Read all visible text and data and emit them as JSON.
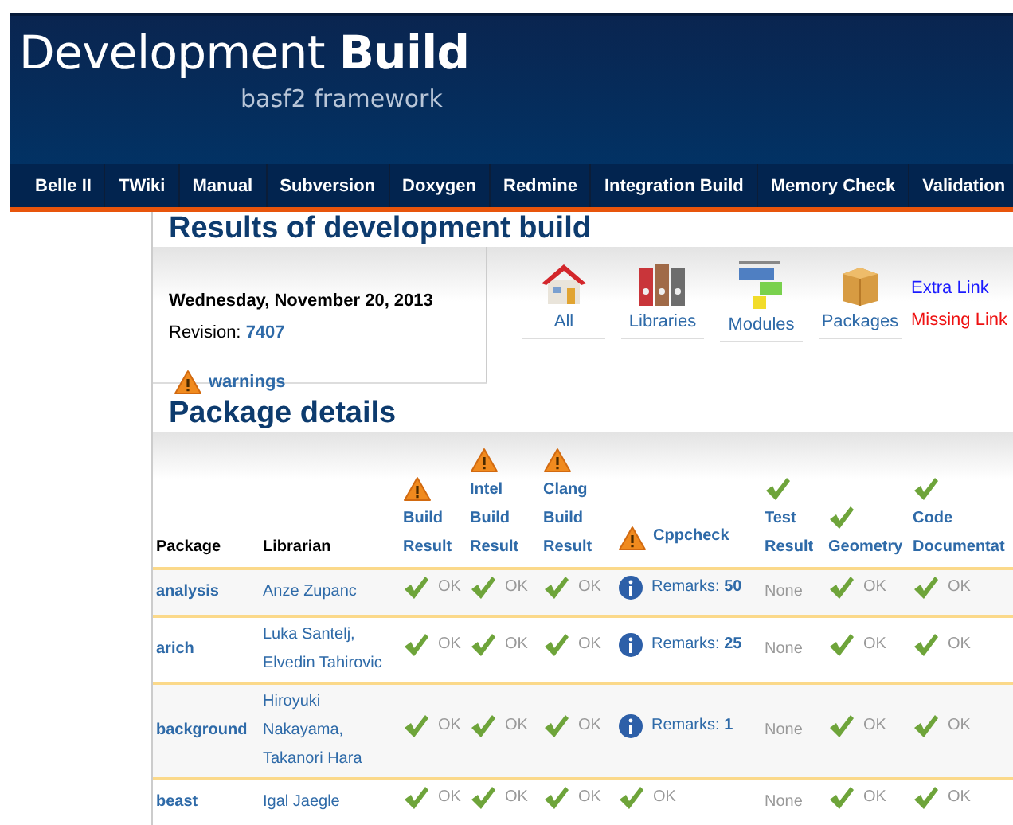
{
  "header": {
    "title": "Development **Build**",
    "subtitle": "basf2 framework"
  },
  "nav": [
    {
      "label": "Belle II"
    },
    {
      "label": "TWiki"
    },
    {
      "label": "Manual"
    },
    {
      "label": "Subversion"
    },
    {
      "label": "Doxygen"
    },
    {
      "label": "Redmine"
    },
    {
      "label": "Integration Build"
    },
    {
      "label": "Memory Check"
    },
    {
      "label": "Validation"
    }
  ],
  "page_title": "Results of development build",
  "summary": {
    "date": "Wednesday, November 20, 2013",
    "revision_label": "Revision:",
    "revision": "7407",
    "warnings": "warnings",
    "views": [
      {
        "kind": "house",
        "label": "All"
      },
      {
        "kind": "binders",
        "label": "Libraries"
      },
      {
        "kind": "blocks",
        "label": "Modules"
      },
      {
        "kind": "box",
        "label": "Packages"
      }
    ],
    "links": [
      {
        "kind": "extra",
        "label": "Extra Link"
      },
      {
        "kind": "missing",
        "label": "Missing Link"
      }
    ]
  },
  "details_title": "Package details",
  "table": {
    "columns": [
      {
        "kind": "plain",
        "label": "Package"
      },
      {
        "kind": "plain",
        "label": "Librarian"
      },
      {
        "kind": "warning",
        "label": "Build Result"
      },
      {
        "kind": "warning",
        "label": "Intel Build Result"
      },
      {
        "kind": "warning",
        "label": "Clang Build Result"
      },
      {
        "kind": "warning",
        "label": "Cppcheck"
      },
      {
        "kind": "ok",
        "label": "Test Result"
      },
      {
        "kind": "ok",
        "label": "Geometry"
      },
      {
        "kind": "ok",
        "label": "Code Documentat"
      }
    ],
    "rows": [
      {
        "cells": [
          {
            "kind": "package",
            "text": "analysis"
          },
          {
            "kind": "librarian",
            "text": "Anze Zupanc"
          },
          {
            "kind": "ok",
            "text": "OK"
          },
          {
            "kind": "ok",
            "text": "OK"
          },
          {
            "kind": "ok",
            "text": "OK"
          },
          {
            "kind": "remarks",
            "text": "Remarks: **50**"
          },
          {
            "kind": "none",
            "text": "None"
          },
          {
            "kind": "ok",
            "text": "OK"
          },
          {
            "kind": "ok",
            "text": "OK"
          }
        ]
      },
      {
        "cells": [
          {
            "kind": "package",
            "text": "arich"
          },
          {
            "kind": "librarian",
            "text": "Luka Santelj, Elvedin Tahirovic"
          },
          {
            "kind": "ok",
            "text": "OK"
          },
          {
            "kind": "ok",
            "text": "OK"
          },
          {
            "kind": "ok",
            "text": "OK"
          },
          {
            "kind": "remarks",
            "text": "Remarks: **25**"
          },
          {
            "kind": "none",
            "text": "None"
          },
          {
            "kind": "ok",
            "text": "OK"
          },
          {
            "kind": "ok",
            "text": "OK"
          }
        ]
      },
      {
        "cells": [
          {
            "kind": "package",
            "text": "background"
          },
          {
            "kind": "librarian",
            "text": "Hiroyuki Nakayama, Takanori Hara"
          },
          {
            "kind": "ok",
            "text": "OK"
          },
          {
            "kind": "ok",
            "text": "OK"
          },
          {
            "kind": "ok",
            "text": "OK"
          },
          {
            "kind": "remarks",
            "text": "Remarks: **1**"
          },
          {
            "kind": "none",
            "text": "None"
          },
          {
            "kind": "ok",
            "text": "OK"
          },
          {
            "kind": "ok",
            "text": "OK"
          }
        ]
      },
      {
        "cells": [
          {
            "kind": "package",
            "text": "beast"
          },
          {
            "kind": "librarian",
            "text": "Igal Jaegle"
          },
          {
            "kind": "ok",
            "text": "OK"
          },
          {
            "kind": "ok",
            "text": "OK"
          },
          {
            "kind": "ok",
            "text": "OK"
          },
          {
            "kind": "ok",
            "text": "OK"
          },
          {
            "kind": "none",
            "text": "None"
          },
          {
            "kind": "ok",
            "text": "OK"
          },
          {
            "kind": "ok",
            "text": "OK"
          }
        ]
      }
    ]
  }
}
